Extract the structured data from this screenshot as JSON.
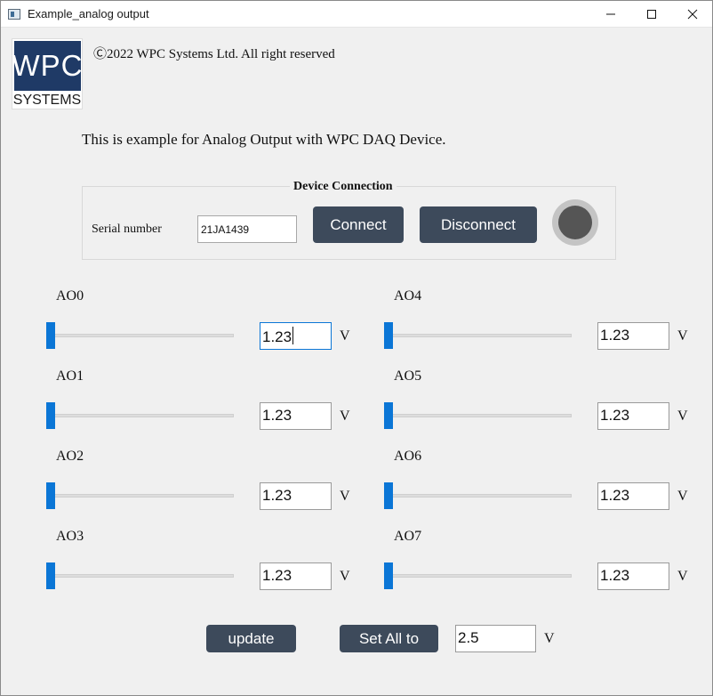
{
  "window": {
    "title": "Example_analog output",
    "controls": [
      "minimize-icon",
      "maximize-icon",
      "close-icon"
    ]
  },
  "logo": {
    "line1": "WPC",
    "line2": "SYSTEMS",
    "color": "#1f3a66"
  },
  "copyright": "Ⓒ2022 WPC Systems Ltd. All right reserved",
  "intro": "This is example for Analog Output with WPC DAQ Device.",
  "device": {
    "group_title": "Device Connection",
    "serial_label": "Serial number",
    "serial_value": "21JA1439",
    "connect_label": "Connect",
    "disconnect_label": "Disconnect",
    "status_led": "off"
  },
  "channels": [
    {
      "label": "AO0",
      "value": "1.23",
      "unit": "V",
      "slider_level": 0.0
    },
    {
      "label": "AO1",
      "value": "1.23",
      "unit": "V",
      "slider_level": 0.0
    },
    {
      "label": "AO2",
      "value": "1.23",
      "unit": "V",
      "slider_level": 0.0
    },
    {
      "label": "AO3",
      "value": "1.23",
      "unit": "V",
      "slider_level": 0.0
    },
    {
      "label": "AO4",
      "value": "1.23",
      "unit": "V",
      "slider_level": 0.0
    },
    {
      "label": "AO5",
      "value": "1.23",
      "unit": "V",
      "slider_level": 0.0
    },
    {
      "label": "AO6",
      "value": "1.23",
      "unit": "V",
      "slider_level": 0.0
    },
    {
      "label": "AO7",
      "value": "1.23",
      "unit": "V",
      "slider_level": 0.0
    }
  ],
  "footer": {
    "update_label": "update",
    "set_all_label": "Set All to",
    "set_all_value": "2.5",
    "unit": "V"
  },
  "colors": {
    "accent": "#0b76d6",
    "button": "#3d4a5b",
    "background": "#f0f0f0"
  }
}
